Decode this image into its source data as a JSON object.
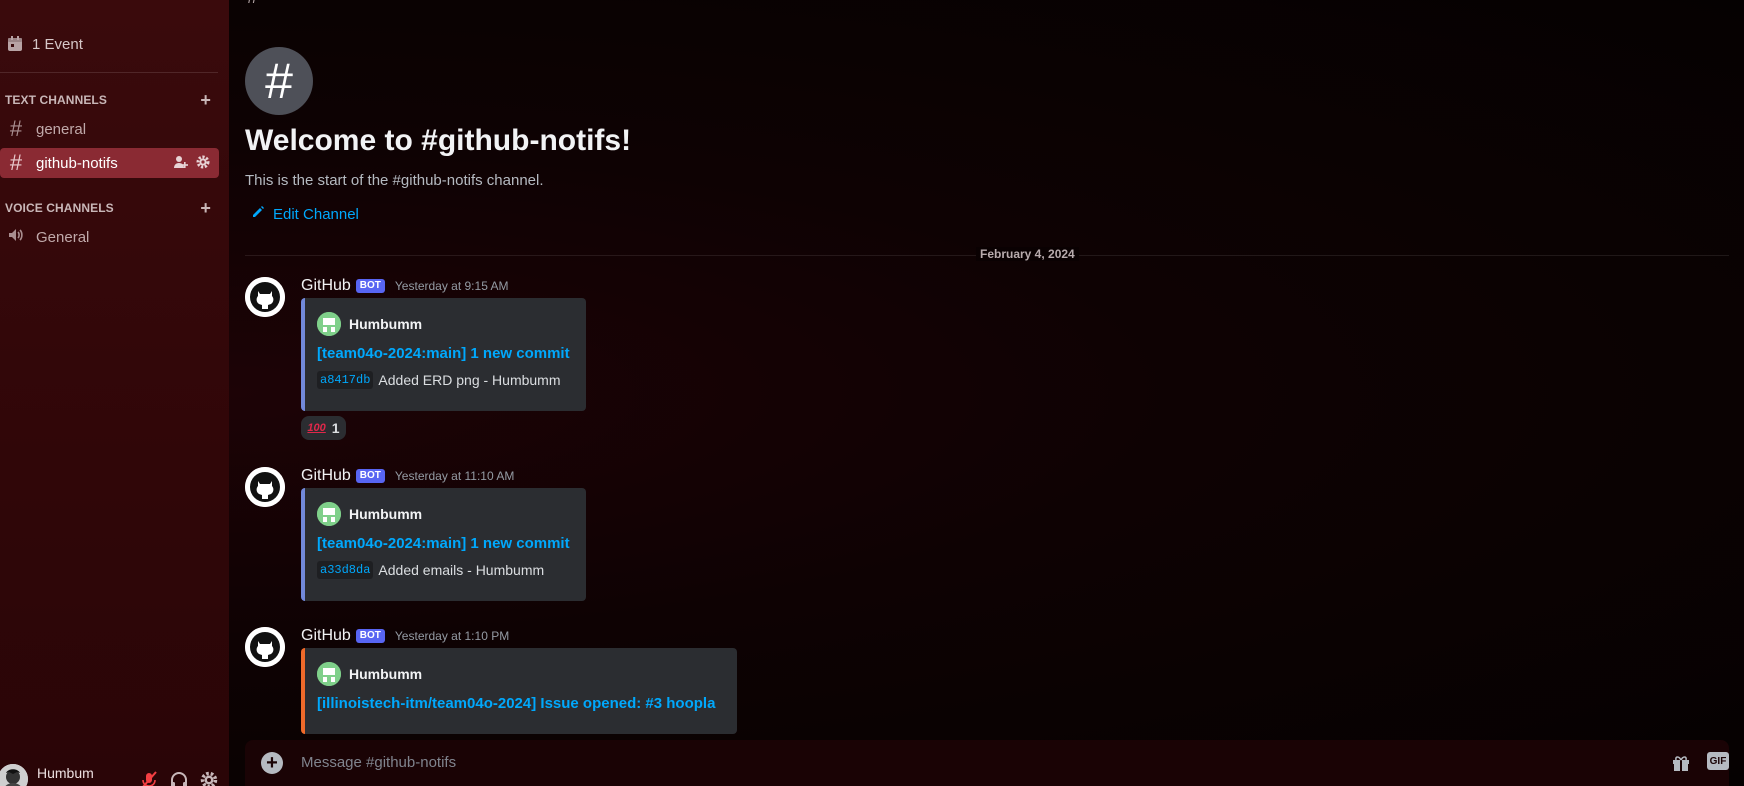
{
  "sidebar": {
    "event_label": "1 Event",
    "text_category": "TEXT CHANNELS",
    "voice_category": "VOICE CHANNELS",
    "text_channels": [
      {
        "name": "general"
      },
      {
        "name": "github-notifs"
      }
    ],
    "voice_channels": [
      {
        "name": "General"
      }
    ]
  },
  "user_panel": {
    "username": "Humbum"
  },
  "channel": {
    "welcome_title": "Welcome to #github-notifs!",
    "start_text": "This is the start of the #github-notifs channel.",
    "edit_label": "Edit Channel",
    "composer_placeholder": "Message #github-notifs"
  },
  "date_divider": "February 4, 2024",
  "messages": [
    {
      "author": "GitHub",
      "tag": "BOT",
      "time": "Yesterday at 9:15 AM",
      "embed": {
        "author": "Humbumm",
        "title": "[team04o-2024:main] 1 new commit",
        "hash": "a8417db",
        "desc": "Added ERD png - Humbumm"
      },
      "reaction": {
        "emoji": "100",
        "count": "1"
      }
    },
    {
      "author": "GitHub",
      "tag": "BOT",
      "time": "Yesterday at 11:10 AM",
      "embed": {
        "author": "Humbumm",
        "title": "[team04o-2024:main] 1 new commit",
        "hash": "a33d8da",
        "desc": "Added emails - Humbumm"
      }
    },
    {
      "author": "GitHub",
      "tag": "BOT",
      "time": "Yesterday at 1:10 PM",
      "embed": {
        "author": "Humbumm",
        "title": "[illinoistech-itm/team04o-2024] Issue opened: #3 hoopla"
      }
    }
  ],
  "colors": {
    "accent_link": "#00a8fc",
    "embed_commit_border": "#7289da",
    "embed_issue_border": "#f06a2a",
    "active_channel": "#8a2a33",
    "bot_tag": "#5865f2"
  }
}
